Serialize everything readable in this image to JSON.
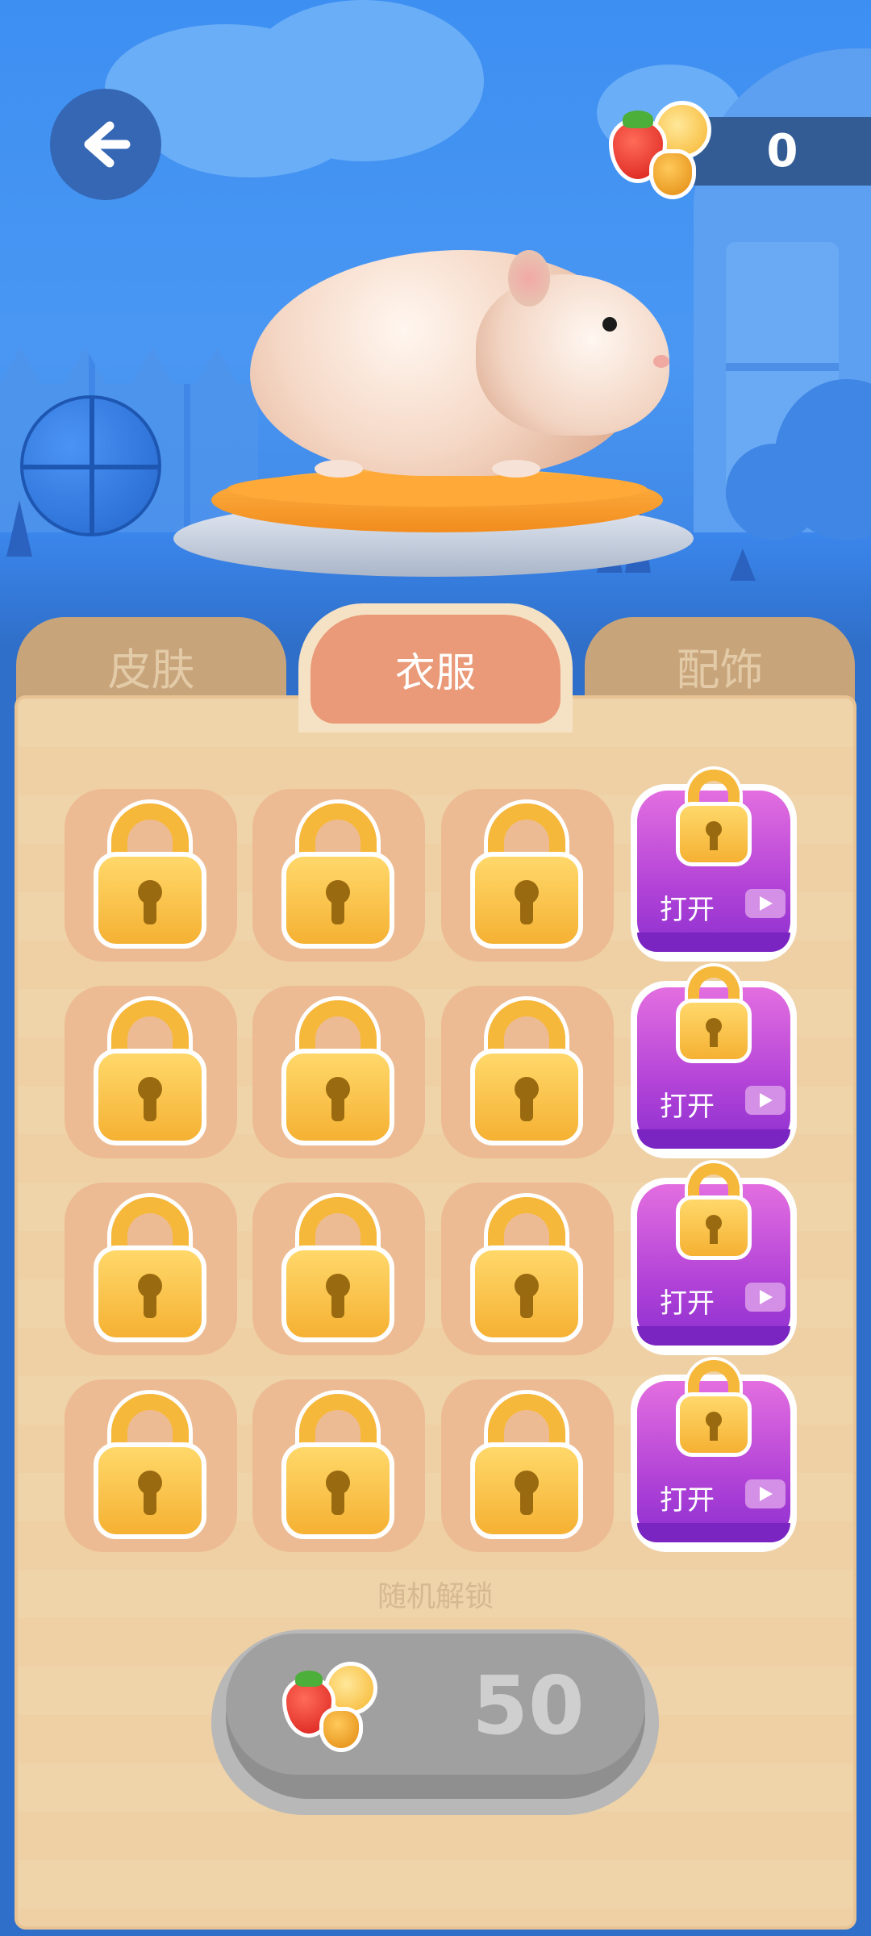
{
  "hud": {
    "currency_value": "0",
    "currency_icon": "fruit-coin-icon",
    "back_icon": "arrow-left-icon"
  },
  "tabs": [
    {
      "label": "皮肤",
      "active": false
    },
    {
      "label": "衣服",
      "active": true
    },
    {
      "label": "配饰",
      "active": false
    }
  ],
  "grid": {
    "rows": 4,
    "locked_per_row": 3,
    "ad_button_label": "打开",
    "lock_icon": "padlock-icon",
    "video_icon": "video-play-icon"
  },
  "random_unlock": {
    "label": "随机解锁",
    "cost": "50",
    "currency_icon": "fruit-coin-icon"
  },
  "colors": {
    "accent_tab": "#ea9a78",
    "inactive_tab": "#c8a47b",
    "ad_purple": "#b243d7",
    "lock_gold": "#f6b83b",
    "panel_bg": "#efd3a9"
  }
}
